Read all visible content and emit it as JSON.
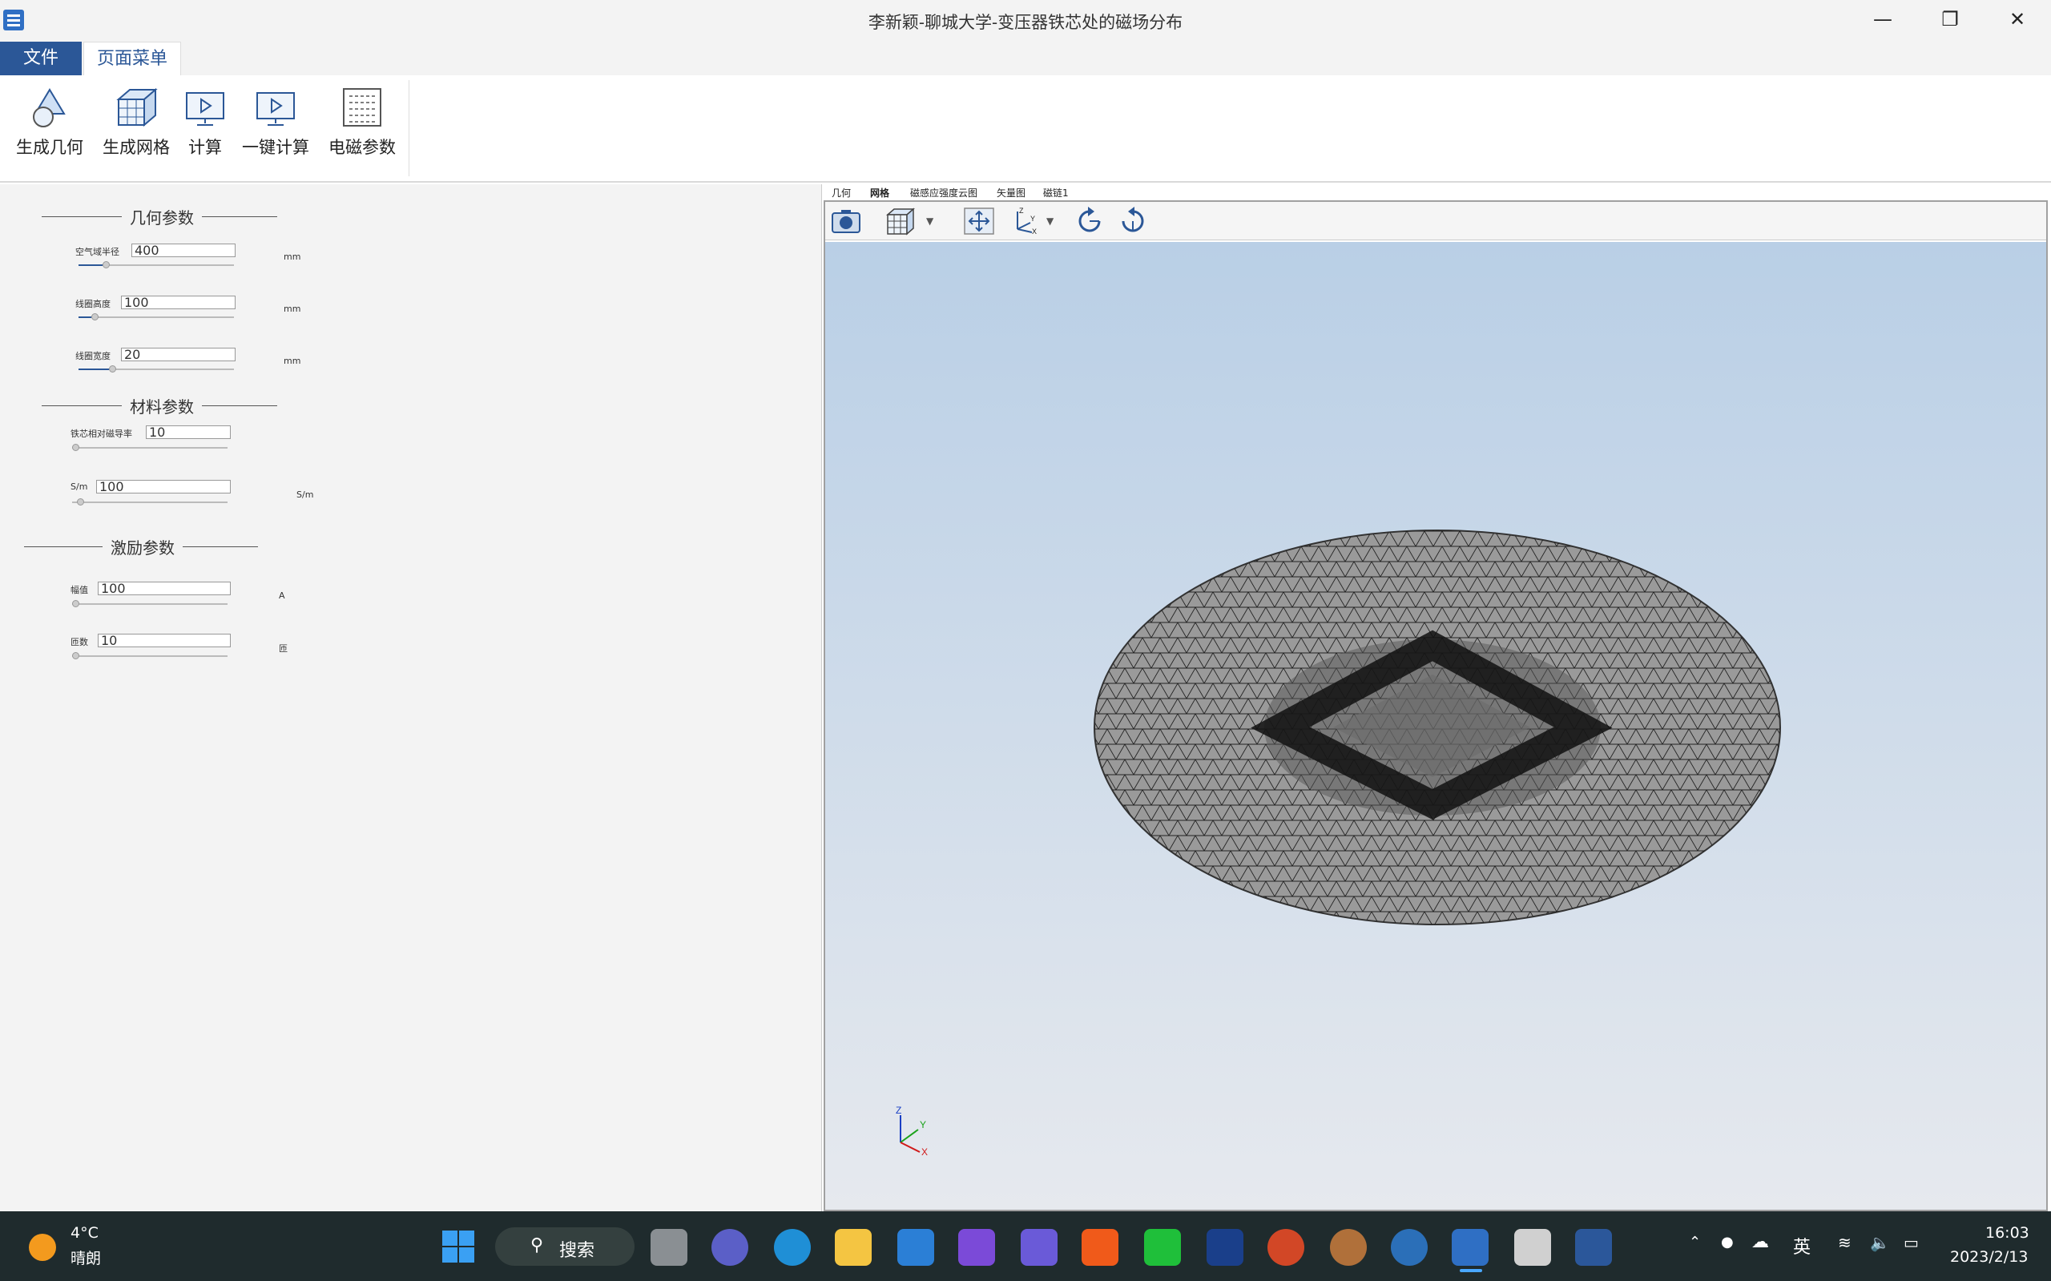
{
  "window": {
    "title": "李新颖-聊城大学-变压器铁芯处的磁场分布",
    "minimize_icon": "minimize-icon",
    "restore_icon": "restore-icon",
    "close_icon": "close-icon"
  },
  "menu": {
    "file_tab": "文件",
    "page_tab": "页面菜单"
  },
  "ribbon": {
    "buttons": [
      {
        "label": "生成几何",
        "icon": "geometry-icon"
      },
      {
        "label": "生成网格",
        "icon": "mesh-cube-icon"
      },
      {
        "label": "计算",
        "icon": "monitor-play-icon"
      },
      {
        "label": "一键计算",
        "icon": "monitor-play-icon"
      },
      {
        "label": "电磁参数",
        "icon": "grid-table-icon"
      }
    ]
  },
  "panel": {
    "geometry_group": "几何参数",
    "material_group": "材料参数",
    "excitation_group": "激励参数",
    "params": {
      "air_radius": {
        "label": "空气域半径",
        "value": "400",
        "unit": "mm",
        "slider": 0.15
      },
      "coil_height": {
        "label": "线圈高度",
        "value": "100",
        "unit": "mm",
        "slider": 0.08
      },
      "coil_width": {
        "label": "线圈宽度",
        "value": "20",
        "unit": "mm",
        "slider": 0.2
      },
      "permeability": {
        "label": "铁芯相对磁导率",
        "value": "10",
        "unit": "",
        "slider": 0.0
      },
      "conductivity": {
        "label": "S/m",
        "value": "100",
        "unit": "S/m",
        "slider": 0.03
      },
      "amplitude": {
        "label": "幅值",
        "value": "100",
        "unit": "A",
        "slider": 0.0
      },
      "turns": {
        "label": "匝数",
        "value": "10",
        "unit": "匝",
        "slider": 0.0
      }
    }
  },
  "viewer": {
    "tabs": [
      "几何",
      "网格",
      "磁感应强度云图",
      "矢量图",
      "磁链1"
    ],
    "active_tab": "网格",
    "toolbar": [
      "camera-icon",
      "view-cube-icon",
      "dropdown-icon",
      "fit-view-icon",
      "axes-icon",
      "dropdown-icon",
      "rotate-left-icon",
      "rotate-right-icon"
    ],
    "triad": {
      "z": "Z",
      "y": "Y",
      "x": "X"
    }
  },
  "taskbar": {
    "weather_temp": "4°C",
    "weather_desc": "晴朗",
    "search_label": "搜索",
    "ime": "英",
    "time": "16:03",
    "date": "2023/2/13"
  }
}
